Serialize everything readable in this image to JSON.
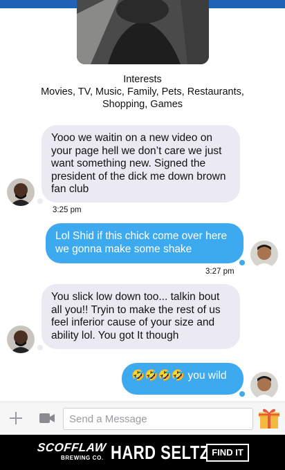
{
  "profile": {
    "interests_title": "Interests",
    "interests_list": "Movies, TV, Music, Family, Pets, Restaurants, Shopping, Games"
  },
  "messages": [
    {
      "direction": "incoming",
      "text": "Yooo we waitin on a new video on your page hell we don’t care we just want something new. Signed the president of the dick me down brown fan club",
      "time": "3:25 pm"
    },
    {
      "direction": "outgoing",
      "text": "Lol Shid if this chick come over here we gonna make some shake",
      "time": "3:27 pm"
    },
    {
      "direction": "incoming",
      "text": "You slick low down too...  talkin bout all you!! Tryin to make the rest of us feel inferior cause of your size and ability lol. You got It though"
    },
    {
      "direction": "outgoing",
      "text": "🤣🤣🤣🤣 you wild"
    }
  ],
  "composer": {
    "placeholder": "Send a Message"
  },
  "icons": {
    "plus": "plus-icon",
    "camera": "video-camera-icon",
    "gift": "gift-icon"
  },
  "ad": {
    "brand": "SCOFFLAW",
    "brand_sub": "BREWING CO.",
    "product": "HARD SELTZER",
    "cta": "FIND IT"
  },
  "colors": {
    "header": "#1f63b5",
    "outgoing_bubble": "#3daaf0",
    "incoming_bubble": "#ebeaf3",
    "gift": "#f5a623"
  }
}
